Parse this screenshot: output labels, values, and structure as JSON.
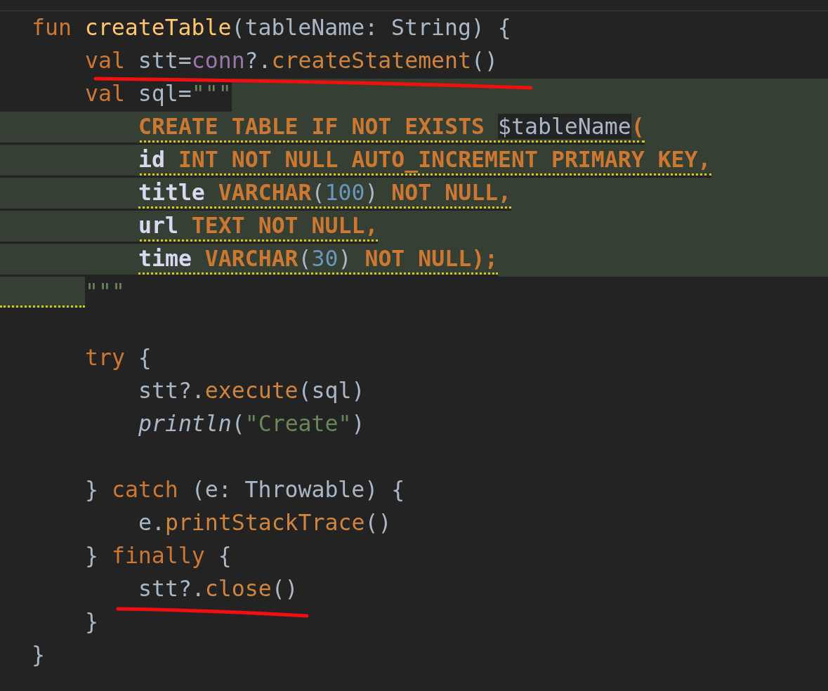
{
  "editor": {
    "lines": [
      {
        "kind": "code",
        "dotted": false,
        "tokens": [
          {
            "kind": "keyword",
            "text": "fun "
          },
          {
            "kind": "function",
            "text": "createTable"
          },
          {
            "kind": "plain",
            "text": "(tableName: String) {"
          }
        ],
        "children": [
          {
            "kind": "code",
            "dotted": false,
            "tokens": [
              {
                "kind": "keyword",
                "text": "val"
              },
              {
                "kind": "plain",
                "text": " stt="
              },
              {
                "kind": "property",
                "text": "conn"
              },
              {
                "kind": "plain",
                "text": "?."
              },
              {
                "kind": "call",
                "text": "createStatement"
              },
              {
                "kind": "plain",
                "text": "()"
              }
            ]
          },
          {
            "kind": "injection-start",
            "dotted": false,
            "tokens": [
              {
                "kind": "keyword",
                "text": "val"
              },
              {
                "kind": "plain",
                "text": " sql="
              },
              {
                "kind": "string",
                "text": "\"\"\""
              }
            ],
            "children": [
              {
                "kind": "injected",
                "dotted": true,
                "tokens": [
                  {
                    "kind": "sql",
                    "text": "CREATE TABLE IF NOT EXISTS "
                  },
                  {
                    "kind": "interpolation",
                    "text": "$tableName"
                  },
                  {
                    "kind": "sql",
                    "text": "("
                  }
                ]
              },
              {
                "kind": "injected",
                "dotted": true,
                "tokens": [
                  {
                    "kind": "column",
                    "text": "id"
                  },
                  {
                    "kind": "sql",
                    "text": " INT NOT NULL AUTO_INCREMENT PRIMARY KEY,"
                  }
                ]
              },
              {
                "kind": "injected",
                "dotted": true,
                "tokens": [
                  {
                    "kind": "column",
                    "text": "title"
                  },
                  {
                    "kind": "sql",
                    "text": " VARCHAR"
                  },
                  {
                    "kind": "plain",
                    "text": "("
                  },
                  {
                    "kind": "number",
                    "text": "100"
                  },
                  {
                    "kind": "plain",
                    "text": ")"
                  },
                  {
                    "kind": "sql",
                    "text": " NOT NULL,"
                  }
                ]
              },
              {
                "kind": "injected",
                "dotted": true,
                "tokens": [
                  {
                    "kind": "column",
                    "text": "url"
                  },
                  {
                    "kind": "sql",
                    "text": " TEXT NOT NULL,"
                  }
                ]
              },
              {
                "kind": "injected",
                "dotted": true,
                "tokens": [
                  {
                    "kind": "column",
                    "text": "time"
                  },
                  {
                    "kind": "sql",
                    "text": " VARCHAR"
                  },
                  {
                    "kind": "plain",
                    "text": "("
                  },
                  {
                    "kind": "number",
                    "text": "30"
                  },
                  {
                    "kind": "plain",
                    "text": ")"
                  },
                  {
                    "kind": "sql",
                    "text": " NOT NULL);"
                  }
                ]
              }
            ]
          },
          {
            "kind": "injection-end",
            "dotted": true,
            "tokens": [
              {
                "kind": "string",
                "text": "\"\"\""
              }
            ]
          },
          {
            "kind": "blank"
          },
          {
            "kind": "code",
            "dotted": false,
            "tokens": [
              {
                "kind": "keyword",
                "text": "try"
              },
              {
                "kind": "plain",
                "text": " {"
              }
            ],
            "children": [
              {
                "kind": "code",
                "dotted": false,
                "tokens": [
                  {
                    "kind": "plain",
                    "text": "stt?."
                  },
                  {
                    "kind": "call",
                    "text": "execute"
                  },
                  {
                    "kind": "plain",
                    "text": "(sql)"
                  }
                ]
              },
              {
                "kind": "code",
                "dotted": false,
                "tokens": [
                  {
                    "kind": "italic",
                    "text": "println"
                  },
                  {
                    "kind": "plain",
                    "text": "("
                  },
                  {
                    "kind": "string",
                    "text": "\"Create\""
                  },
                  {
                    "kind": "plain",
                    "text": ")"
                  }
                ]
              },
              {
                "kind": "blank"
              }
            ]
          },
          {
            "kind": "code",
            "dotted": false,
            "tokens": [
              {
                "kind": "plain",
                "text": "} "
              },
              {
                "kind": "keyword",
                "text": "catch"
              },
              {
                "kind": "plain",
                "text": " (e: Throwable) {"
              }
            ],
            "children": [
              {
                "kind": "code",
                "dotted": false,
                "tokens": [
                  {
                    "kind": "plain",
                    "text": "e."
                  },
                  {
                    "kind": "call",
                    "text": "printStackTrace"
                  },
                  {
                    "kind": "plain",
                    "text": "()"
                  }
                ]
              }
            ]
          },
          {
            "kind": "code",
            "dotted": false,
            "tokens": [
              {
                "kind": "plain",
                "text": "} "
              },
              {
                "kind": "keyword",
                "text": "finally"
              },
              {
                "kind": "plain",
                "text": " {"
              }
            ],
            "children": [
              {
                "kind": "code",
                "dotted": false,
                "tokens": [
                  {
                    "kind": "plain",
                    "text": "stt?."
                  },
                  {
                    "kind": "call",
                    "text": "close"
                  },
                  {
                    "kind": "plain",
                    "text": "()"
                  }
                ]
              }
            ]
          },
          {
            "kind": "code",
            "dotted": false,
            "tokens": [
              {
                "kind": "plain",
                "text": "}"
              }
            ]
          }
        ]
      },
      {
        "kind": "code",
        "dotted": false,
        "tokens": [
          {
            "kind": "plain",
            "text": "}"
          }
        ]
      }
    ]
  }
}
